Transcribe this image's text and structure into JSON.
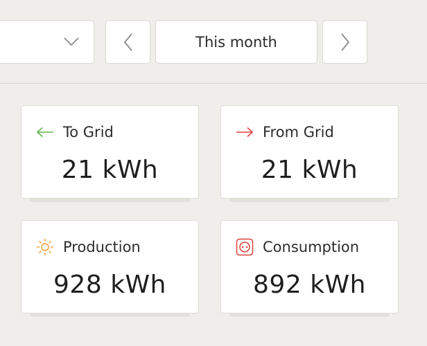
{
  "toolbar": {
    "dropdown": {
      "value": "",
      "icon": "chevron-down-icon"
    },
    "prev_icon": "chevron-left-icon",
    "period_label": "This month",
    "next_icon": "chevron-right-icon"
  },
  "cards": {
    "to_grid": {
      "label": "To Grid",
      "value": "21 kWh",
      "icon": "arrow-left-icon",
      "icon_color": "#5fb64a"
    },
    "from_grid": {
      "label": "From Grid",
      "value": "21 kWh",
      "icon": "arrow-right-icon",
      "icon_color": "#e0413c"
    },
    "production": {
      "label": "Production",
      "value": "928 kWh",
      "icon": "sun-icon",
      "icon_color": "#f0a23b"
    },
    "consumption": {
      "label": "Consumption",
      "value": "892 kWh",
      "icon": "power-socket-icon",
      "icon_color": "#e0413c"
    }
  }
}
